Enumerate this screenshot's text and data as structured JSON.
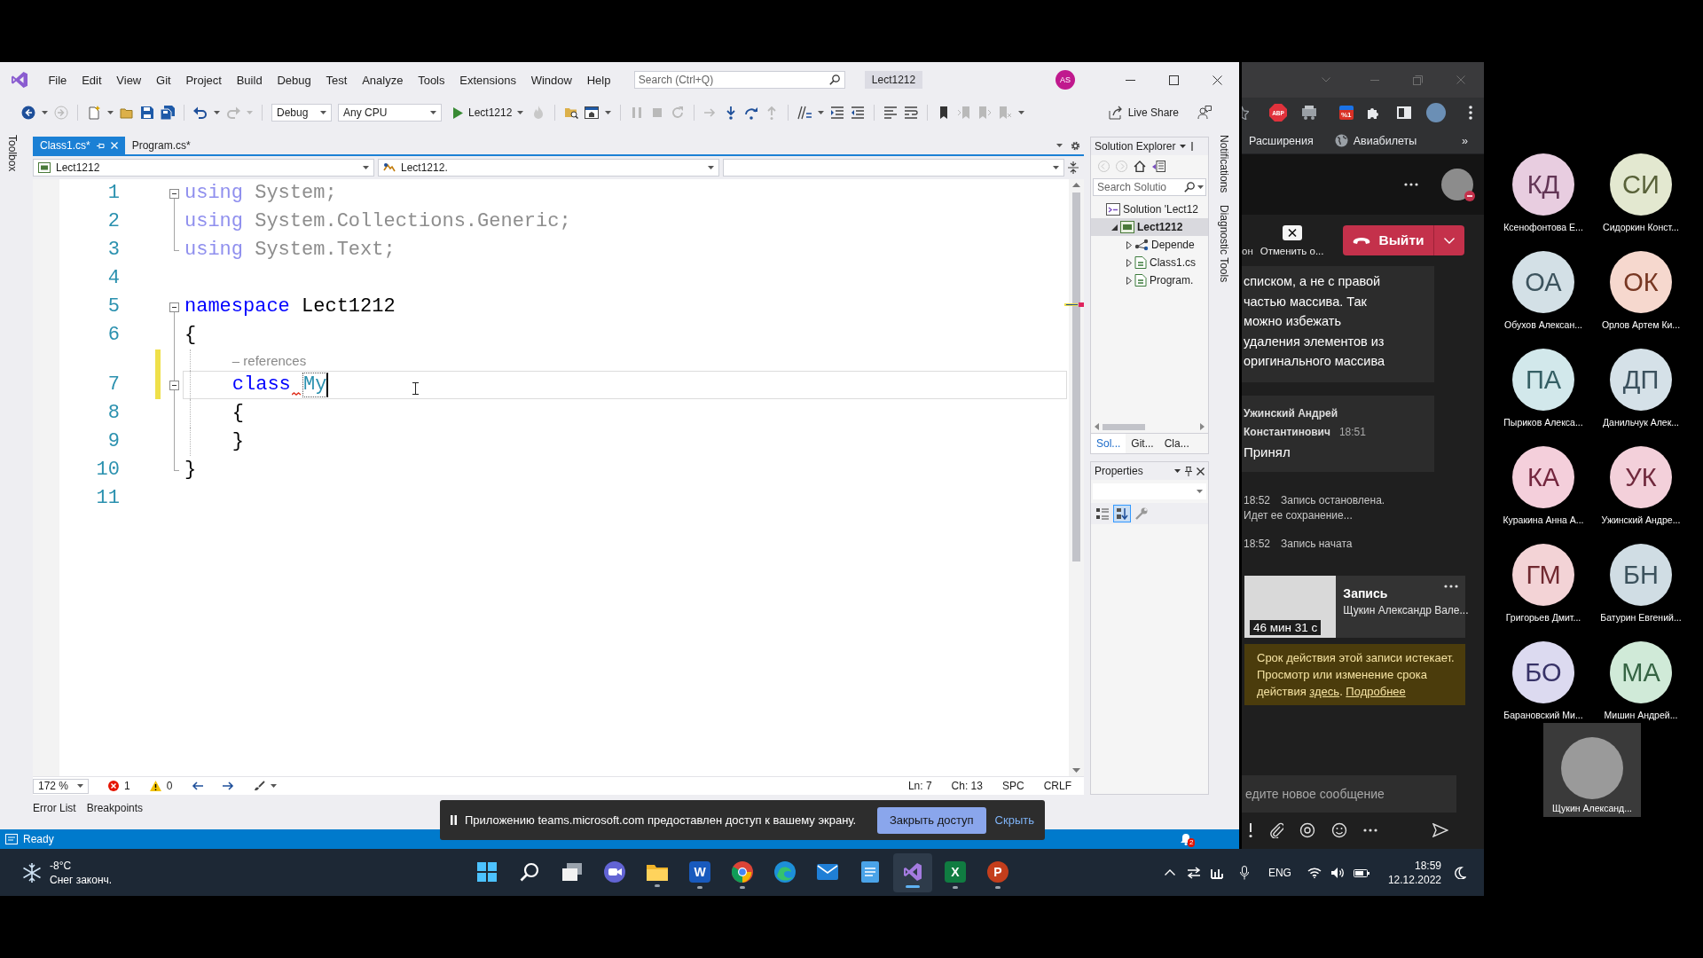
{
  "vs": {
    "menu": [
      "File",
      "Edit",
      "View",
      "Git",
      "Project",
      "Build",
      "Debug",
      "Test",
      "Analyze",
      "Tools",
      "Extensions",
      "Window",
      "Help"
    ],
    "search": {
      "placeholder": "Search (Ctrl+Q)"
    },
    "solution_badge": "Lect1212",
    "account": "AS",
    "toolbar": {
      "configuration": "Debug",
      "platform": "Any CPU",
      "start": "Lect1212",
      "live_share": "Live Share"
    },
    "toolbox": "Toolbox",
    "tabs": [
      {
        "label": "Class1.cs*",
        "selected": true
      },
      {
        "label": "Program.cs*",
        "selected": false
      }
    ],
    "navigation": {
      "project": "Lect1212",
      "member": "Lect1212."
    },
    "code": [
      {
        "number": "1",
        "kind": "fold-start",
        "modified": false,
        "current": false,
        "tokens": [
          {
            "kind": "faded-keyword",
            "text": "using"
          },
          {
            "kind": "faded",
            "text": " System;"
          }
        ]
      },
      {
        "number": "2",
        "kind": "fold-inner",
        "modified": false,
        "current": false,
        "tokens": [
          {
            "kind": "faded-keyword",
            "text": "using"
          },
          {
            "kind": "faded",
            "text": " System.Collections.Generic;"
          }
        ]
      },
      {
        "number": "3",
        "kind": "fold-end",
        "modified": false,
        "current": false,
        "tokens": [
          {
            "kind": "faded-keyword",
            "text": "using"
          },
          {
            "kind": "faded",
            "text": " System.Text;"
          }
        ]
      },
      {
        "number": "4",
        "kind": "plain",
        "modified": false,
        "current": false
      },
      {
        "number": "5",
        "kind": "fold-start",
        "modified": false,
        "current": false,
        "tokens": [
          {
            "kind": "keyword",
            "text": "namespace"
          },
          {
            "kind": "plain",
            "text": " Lect1212"
          }
        ]
      },
      {
        "number": "6",
        "kind": "fold-inner",
        "modified": false,
        "current": false,
        "tokens": [
          {
            "kind": "plain",
            "text": "{"
          }
        ],
        "children": [
          {
            "number": "7",
            "kind": "fold-start",
            "modified": true,
            "current": true,
            "codelens": "– references",
            "tokens": [
              {
                "kind": "keyword",
                "text": "class ",
                "error": true
              },
              {
                "kind": "rename",
                "text": "My",
                "error": false
              }
            ]
          },
          {
            "number": "8",
            "kind": "fold-inner",
            "modified": false,
            "current": false,
            "tokens": [
              {
                "kind": "plain",
                "text": "{"
              }
            ]
          },
          {
            "number": "9",
            "kind": "fold-inner",
            "modified": false,
            "current": false,
            "tokens": [
              {
                "kind": "plain",
                "text": "}"
              }
            ]
          }
        ]
      },
      {
        "number": "10",
        "kind": "fold-end",
        "modified": false,
        "current": false,
        "tokens": [
          {
            "kind": "plain",
            "text": "}"
          }
        ]
      },
      {
        "number": "11",
        "kind": "plain",
        "modified": false,
        "current": false
      }
    ],
    "editor_footer": {
      "zoom": "172 %",
      "errors": "1",
      "warnings": "0",
      "line": "Ln: 7",
      "column": "Ch: 13",
      "indent": "SPC",
      "line_ending": "CRLF"
    },
    "tool_tabs": [
      "Error List",
      "Breakpoints"
    ],
    "solution_explorer": {
      "title": "Solution Explorer",
      "search": {
        "placeholder": "Search Solutio"
      },
      "tree": [
        {
          "label": "Solution 'Lect12",
          "kind": "solution",
          "selected": false,
          "children": [
            {
              "label": "Lect1212",
              "kind": "project",
              "selected": true,
              "expanded": true,
              "children": [
                {
                  "label": "Depende",
                  "kind": "dependencies",
                  "selected": false,
                  "expanded": false
                },
                {
                  "label": "Class1.cs",
                  "kind": "csharp",
                  "selected": false,
                  "expanded": false
                },
                {
                  "label": "Program.",
                  "kind": "csharp",
                  "selected": false,
                  "expanded": false
                }
              ]
            }
          ]
        }
      ],
      "tabs": [
        {
          "label": "Sol...",
          "selected": true
        },
        {
          "label": "Git...",
          "selected": false
        },
        {
          "label": "Cla...",
          "selected": false
        }
      ]
    },
    "properties": {
      "title": "Properties",
      "views": [
        {
          "kind": "categorized",
          "selected": false
        },
        {
          "kind": "alphabetical",
          "selected": true
        },
        {
          "kind": "pages",
          "selected": false
        }
      ]
    },
    "side_tabs": [
      "Notifications",
      "Diagnostic Tools"
    ],
    "status": {
      "text": "Ready",
      "notifications": "2"
    }
  },
  "share_notice": {
    "text": "Приложению teams.microsoft.com предоставлен доступ к вашему экрану.",
    "stop": "Закрыть доступ",
    "hide": "Скрыть"
  },
  "browser": {
    "toolbar_buttons": [
      {
        "kind": "abp",
        "label": "ABP"
      },
      {
        "kind": "tool"
      },
      {
        "kind": "discount",
        "label": "%1"
      },
      {
        "kind": "puzzle"
      },
      {
        "kind": "sidebar"
      }
    ],
    "bookmarks": [
      {
        "kind": "plain",
        "label": "Расширения"
      },
      {
        "kind": "globe",
        "label": "Авиабилеты"
      }
    ],
    "bookmarks_more": "»",
    "teams": {
      "controls": {
        "cut_label": "он",
        "cancel": "Отменить о...",
        "leave": "Выйти"
      },
      "messages": [
        {
          "text": "списком, а не с правой частью массива. Так можно избежать удаления элементов из оригинального массива"
        },
        {
          "author": "Ужинский Андрей Константинович",
          "time": "18:51",
          "text": "Принял"
        }
      ],
      "events": [
        {
          "time": "18:52",
          "text": "Запись остановлена. Идет ее сохранение..."
        },
        {
          "time": "18:52",
          "text": "Запись начата"
        }
      ],
      "recording": {
        "duration": "46 мин 31 с",
        "title": "Запись",
        "author": "Щукин Александр Вале..."
      },
      "expiry_notice": [
        {
          "kind": "text",
          "text": "Срок действия этой записи истекает. Просмотр или изменение срока действия "
        },
        {
          "kind": "link",
          "text": "здесь"
        },
        {
          "kind": "text",
          "text": ". "
        },
        {
          "kind": "link",
          "text": "Подробнее"
        }
      ],
      "compose": {
        "placeholder": "едите новое сообщение"
      }
    }
  },
  "taskbar": {
    "weather": {
      "temperature": "-8°C",
      "condition": "Снег законч."
    },
    "apps": [
      {
        "kind": "start",
        "running": false,
        "selected": false
      },
      {
        "kind": "search",
        "running": false,
        "selected": false
      },
      {
        "kind": "task-view",
        "running": false,
        "selected": false
      },
      {
        "kind": "chat",
        "running": false,
        "selected": false
      },
      {
        "kind": "explorer",
        "running": true,
        "selected": false
      },
      {
        "kind": "word",
        "label": "W",
        "running": true,
        "selected": false
      },
      {
        "kind": "chrome",
        "running": true,
        "selected": false
      },
      {
        "kind": "edge",
        "running": false,
        "selected": false
      },
      {
        "kind": "mail",
        "running": false,
        "selected": false
      },
      {
        "kind": "notepad",
        "running": false,
        "selected": false
      },
      {
        "kind": "visual-studio",
        "running": true,
        "selected": true
      },
      {
        "kind": "excel",
        "label": "X",
        "running": true,
        "selected": false
      },
      {
        "kind": "powerpoint",
        "label": "P",
        "running": true,
        "selected": false
      }
    ],
    "language": "ENG",
    "time": "18:59",
    "date": "12.12.2022"
  },
  "participants": [
    {
      "kind": "initials",
      "initials": "КД",
      "name": "Ксенофонтова Е...",
      "color": "#e8cde0"
    },
    {
      "kind": "initials",
      "initials": "СИ",
      "name": "Сидоркин Конст...",
      "color": "#e3e8d0"
    },
    {
      "kind": "initials",
      "initials": "ОА",
      "name": "Обухов Алексан...",
      "color": "#d3e0e6"
    },
    {
      "kind": "initials",
      "initials": "ОК",
      "name": "Орлов Артем Ки...",
      "color": "#f6d8ce"
    },
    {
      "kind": "initials",
      "initials": "ПА",
      "name": "Пыриков Алекса...",
      "color": "#d2e8eb"
    },
    {
      "kind": "initials",
      "initials": "ДП",
      "name": "Данильчук Алек...",
      "color": "#d5e1e8"
    },
    {
      "kind": "initials",
      "initials": "КА",
      "name": "Куракина Анна А...",
      "color": "#f4cfdb"
    },
    {
      "kind": "initials",
      "initials": "УК",
      "name": "Ужинский Андре...",
      "color": "#f3d0da"
    },
    {
      "kind": "initials",
      "initials": "ГМ",
      "name": "Григорьев Дмит...",
      "color": "#f3d3d6"
    },
    {
      "kind": "initials",
      "initials": "БН",
      "name": "Батурин Евгений...",
      "color": "#d0dde4"
    },
    {
      "kind": "initials",
      "initials": "БО",
      "name": "Барановский Ми...",
      "color": "#dcdaf0"
    },
    {
      "kind": "initials",
      "initials": "МА",
      "name": "Мишин Андрей...",
      "color": "#d0ead8"
    },
    {
      "kind": "photo",
      "name": "Щукин Александ..."
    }
  ]
}
